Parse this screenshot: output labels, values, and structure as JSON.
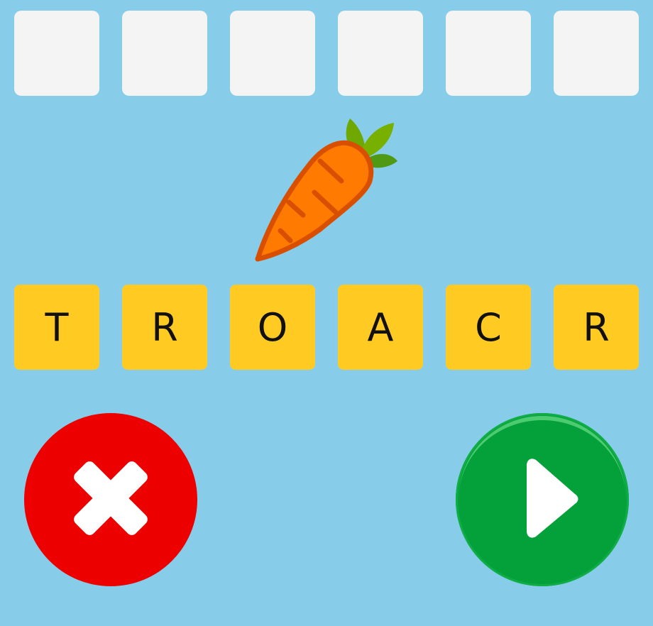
{
  "game": {
    "answer_slots": [
      "",
      "",
      "",
      "",
      "",
      ""
    ],
    "picture_icon": "carrot-icon",
    "letter_tiles": [
      {
        "letter": "T"
      },
      {
        "letter": "R"
      },
      {
        "letter": "O"
      },
      {
        "letter": "A"
      },
      {
        "letter": "C"
      },
      {
        "letter": "R"
      }
    ],
    "clear_button_icon": "close-icon",
    "submit_button_icon": "play-icon"
  },
  "colors": {
    "background": "#87cdea",
    "slot": "#f4f4f4",
    "tile": "#ffcb22",
    "clear_button": "#ec0000",
    "submit_button": "#04a13a",
    "carrot_body": "#ff7a00",
    "carrot_outline": "#d94f00",
    "carrot_leaves": "#6fa800"
  }
}
